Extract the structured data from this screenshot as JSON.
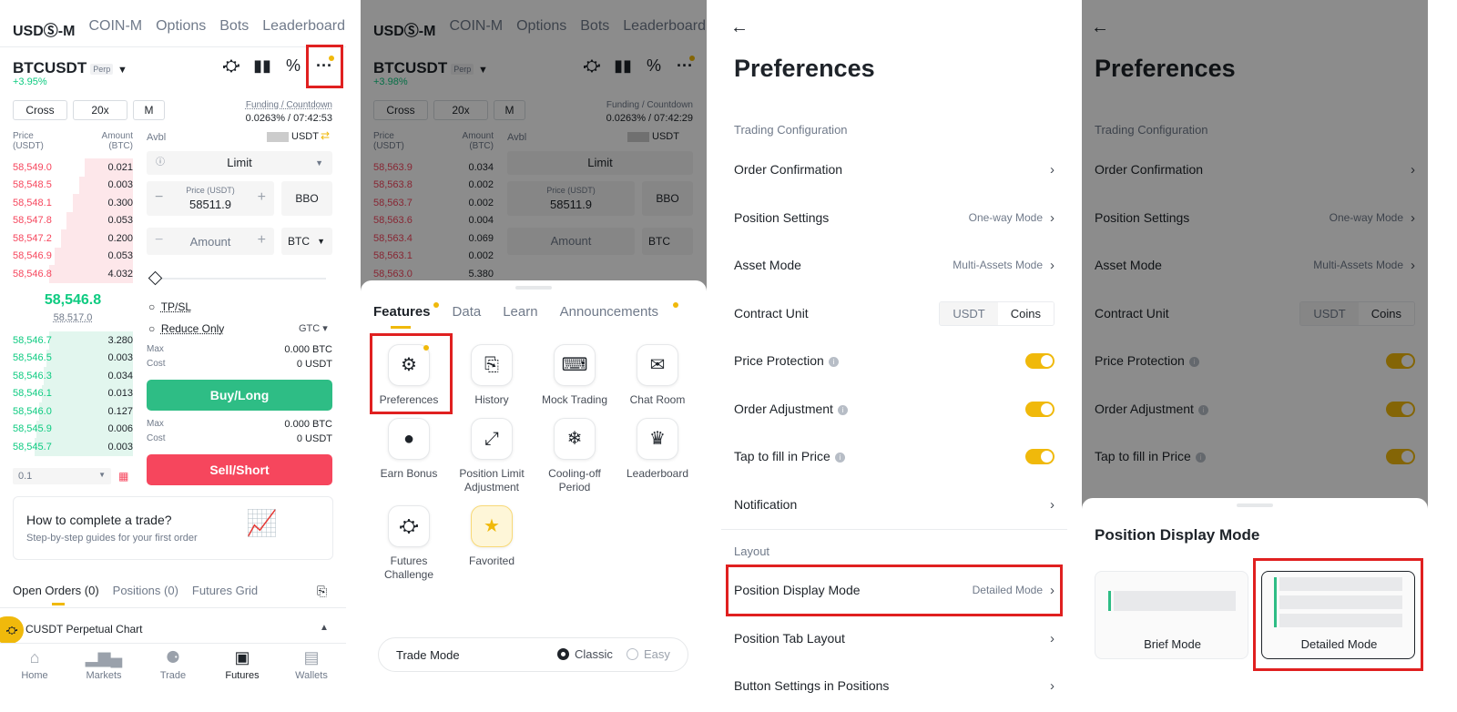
{
  "p1": {
    "tabs": [
      "USDⓈ-M",
      "COIN-M",
      "Options",
      "Bots",
      "Leaderboard"
    ],
    "symbol": "BTCUSDT",
    "perp": "Perp",
    "change": "+3.95%",
    "margin": "Cross",
    "leverage": "20x",
    "mode": "M",
    "funding_label": "Funding / Countdown",
    "funding_value": "0.0263% / 07:42:53",
    "price_header": "Price\n(USDT)",
    "amount_header": "Amount\n(BTC)",
    "avbl_label": "Avbl",
    "avbl_unit": "USDT",
    "asks": [
      [
        "58,549.0",
        "0.021"
      ],
      [
        "58,548.5",
        "0.003"
      ],
      [
        "58,548.1",
        "0.300"
      ],
      [
        "58,547.8",
        "0.053"
      ],
      [
        "58,547.2",
        "0.200"
      ],
      [
        "58,546.9",
        "0.053"
      ],
      [
        "58,546.8",
        "4.032"
      ]
    ],
    "mid_price": "58,546.8",
    "mark_price": "58,517.0",
    "bids": [
      [
        "58,546.7",
        "3.280"
      ],
      [
        "58,546.5",
        "0.003"
      ],
      [
        "58,546.3",
        "0.034"
      ],
      [
        "58,546.1",
        "0.013"
      ],
      [
        "58,546.0",
        "0.127"
      ],
      [
        "58,545.9",
        "0.006"
      ],
      [
        "58,545.7",
        "0.003"
      ]
    ],
    "order_type": "Limit",
    "price_label": "Price (USDT)",
    "price_value": "58511.9",
    "bbo": "BBO",
    "amount_placeholder": "Amount",
    "amount_unit": "BTC",
    "tpsl": "TP/SL",
    "reduce_only": "Reduce Only",
    "tif": "GTC",
    "max_label": "Max",
    "cost_label": "Cost",
    "buy_max": "0.000 BTC",
    "buy_cost": "0 USDT",
    "buy_label": "Buy/Long",
    "sell_max": "0.000 BTC",
    "sell_cost": "0 USDT",
    "sell_label": "Sell/Short",
    "depth_value": "0.1",
    "guide_title": "How to complete a trade?",
    "guide_sub": "Step-by-step guides for your first order",
    "bottom_tabs": [
      "Open Orders (0)",
      "Positions (0)",
      "Futures Grid"
    ],
    "chart_bar": "CUSDT Perpetual  Chart",
    "nav": [
      "Home",
      "Markets",
      "Trade",
      "Futures",
      "Wallets"
    ]
  },
  "p2": {
    "tabs": [
      "USDⓈ-M",
      "COIN-M",
      "Options",
      "Bots",
      "Leaderboard"
    ],
    "symbol": "BTCUSDT",
    "perp": "Perp",
    "change": "+3.98%",
    "margin": "Cross",
    "leverage": "20x",
    "mode": "M",
    "funding_label": "Funding / Countdown",
    "funding_value": "0.0263% / 07:42:29",
    "price_header": "Price\n(USDT)",
    "amount_header": "Amount\n(BTC)",
    "avbl_label": "Avbl",
    "avbl_unit": "USDT",
    "asks": [
      [
        "58,563.9",
        "0.034"
      ],
      [
        "58,563.8",
        "0.002"
      ],
      [
        "58,563.7",
        "0.002"
      ],
      [
        "58,563.6",
        "0.004"
      ],
      [
        "58,563.4",
        "0.069"
      ],
      [
        "58,563.1",
        "0.002"
      ],
      [
        "58,563.0",
        "5.380"
      ]
    ],
    "order_type": "Limit",
    "price_label": "Price (USDT)",
    "price_value": "58511.9",
    "bbo": "BBO",
    "amount_placeholder": "Amount",
    "amount_unit": "BTC",
    "sheet_tabs": [
      "Features",
      "Data",
      "Learn",
      "Announcements"
    ],
    "features": [
      "Preferences",
      "History",
      "Mock Trading",
      "Chat Room",
      "Earn Bonus",
      "Position Limit Adjustment",
      "Cooling-off Period",
      "Leaderboard",
      "Futures Challenge",
      "Favorited"
    ],
    "trade_mode_label": "Trade Mode",
    "trade_mode_classic": "Classic",
    "trade_mode_easy": "Easy"
  },
  "p3": {
    "title": "Preferences",
    "section_trading": "Trading Configuration",
    "order_confirmation": "Order Confirmation",
    "position_settings": "Position Settings",
    "position_settings_value": "One-way Mode",
    "asset_mode": "Asset Mode",
    "asset_mode_value": "Multi-Assets Mode",
    "contract_unit": "Contract Unit",
    "unit_usdt": "USDT",
    "unit_coins": "Coins",
    "price_protection": "Price Protection",
    "order_adjustment": "Order Adjustment",
    "tap_fill": "Tap to fill in Price",
    "notification": "Notification",
    "section_layout": "Layout",
    "position_display_mode": "Position Display Mode",
    "position_display_value": "Detailed Mode",
    "position_tab_layout": "Position Tab Layout",
    "button_settings": "Button Settings in Positions"
  },
  "p4": {
    "title": "Preferences",
    "section_trading": "Trading Configuration",
    "order_confirmation": "Order Confirmation",
    "position_settings": "Position Settings",
    "position_settings_value": "One-way Mode",
    "asset_mode": "Asset Mode",
    "asset_mode_value": "Multi-Assets Mode",
    "contract_unit": "Contract Unit",
    "unit_usdt": "USDT",
    "unit_coins": "Coins",
    "price_protection": "Price Protection",
    "order_adjustment": "Order Adjustment",
    "tap_fill": "Tap to fill in Price",
    "sheet_title": "Position Display Mode",
    "brief_mode": "Brief Mode",
    "detailed_mode": "Detailed Mode"
  },
  "colors": {
    "accent": "#f0b90b",
    "buy": "#2ebd85",
    "sell": "#f6465d",
    "highlight": "#e02020"
  }
}
